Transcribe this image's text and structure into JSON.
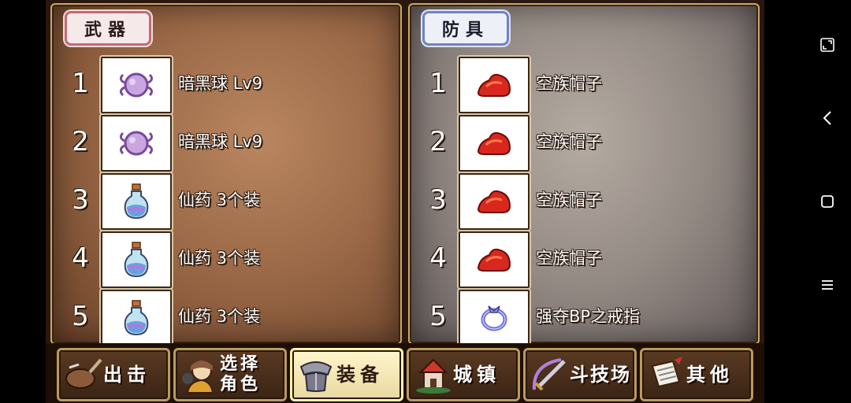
{
  "weapons": {
    "title": "武器",
    "items": [
      {
        "num": "1",
        "name": "暗黑球 Lv9",
        "icon": "dark-orb-icon"
      },
      {
        "num": "2",
        "name": "暗黑球 Lv9",
        "icon": "dark-orb-icon"
      },
      {
        "num": "3",
        "name": "仙药 3个装",
        "icon": "potion-icon"
      },
      {
        "num": "4",
        "name": "仙药 3个装",
        "icon": "potion-icon"
      },
      {
        "num": "5",
        "name": "仙药 3个装",
        "icon": "potion-icon"
      }
    ]
  },
  "armor": {
    "title": "防具",
    "items": [
      {
        "num": "1",
        "name": "空族帽子",
        "icon": "red-hat-icon"
      },
      {
        "num": "2",
        "name": "空族帽子",
        "icon": "red-hat-icon"
      },
      {
        "num": "3",
        "name": "空族帽子",
        "icon": "red-hat-icon"
      },
      {
        "num": "4",
        "name": "空族帽子",
        "icon": "red-hat-icon"
      },
      {
        "num": "5",
        "name": "强夺BP之戒指",
        "icon": "ring-icon"
      }
    ]
  },
  "nav": {
    "sortie": "出击",
    "select_line1": "选择",
    "select_line2": "角色",
    "equip": "装备",
    "town": "城镇",
    "arena": "斗技场",
    "other": "其他",
    "active": "equip"
  }
}
